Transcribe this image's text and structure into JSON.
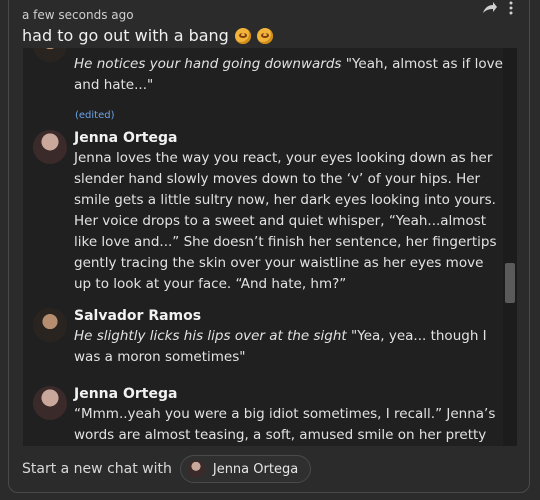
{
  "post": {
    "timestamp": "a few seconds ago",
    "text": "had to go out with a bang",
    "emojis": [
      "rolling-eyes-emoji",
      "rolling-eyes-emoji"
    ]
  },
  "messages": [
    {
      "id": "m0",
      "name": "",
      "action": "He notices your hand going downwards",
      "speech": " \"Yeah, almost as if love and hate...\""
    },
    {
      "id": "m1",
      "edited": "(edited)",
      "name": "Jenna Ortega",
      "text": "Jenna loves the way you react, your eyes looking down as her slender hand slowly moves down to the ‘v’ of your hips. Her smile gets a little sultry now, her dark eyes looking into yours. Her voice drops to a sweet and quiet whisper, “Yeah...almost like love and...” She doesn’t finish her sentence, her fingertips gently tracing the skin over your waistline as her eyes move up to look at your face. “And hate, hm?”"
    },
    {
      "id": "m2",
      "name": "Salvador Ramos",
      "action": "He slightly licks his lips over at the sight",
      "speech": " \"Yea, yea... though I was a moron sometimes\""
    },
    {
      "id": "m3",
      "name": "Jenna Ortega",
      "text": "“Mmm..yeah you were a big idiot sometimes, I recall.” Jenna’s words are almost teasing, a soft, amused smile on her pretty face as she"
    }
  ],
  "footer": {
    "label": "Start a new chat with",
    "chip_name": "Jenna Ortega"
  },
  "icons": {
    "share": "share-icon",
    "more": "more-vertical-icon"
  }
}
